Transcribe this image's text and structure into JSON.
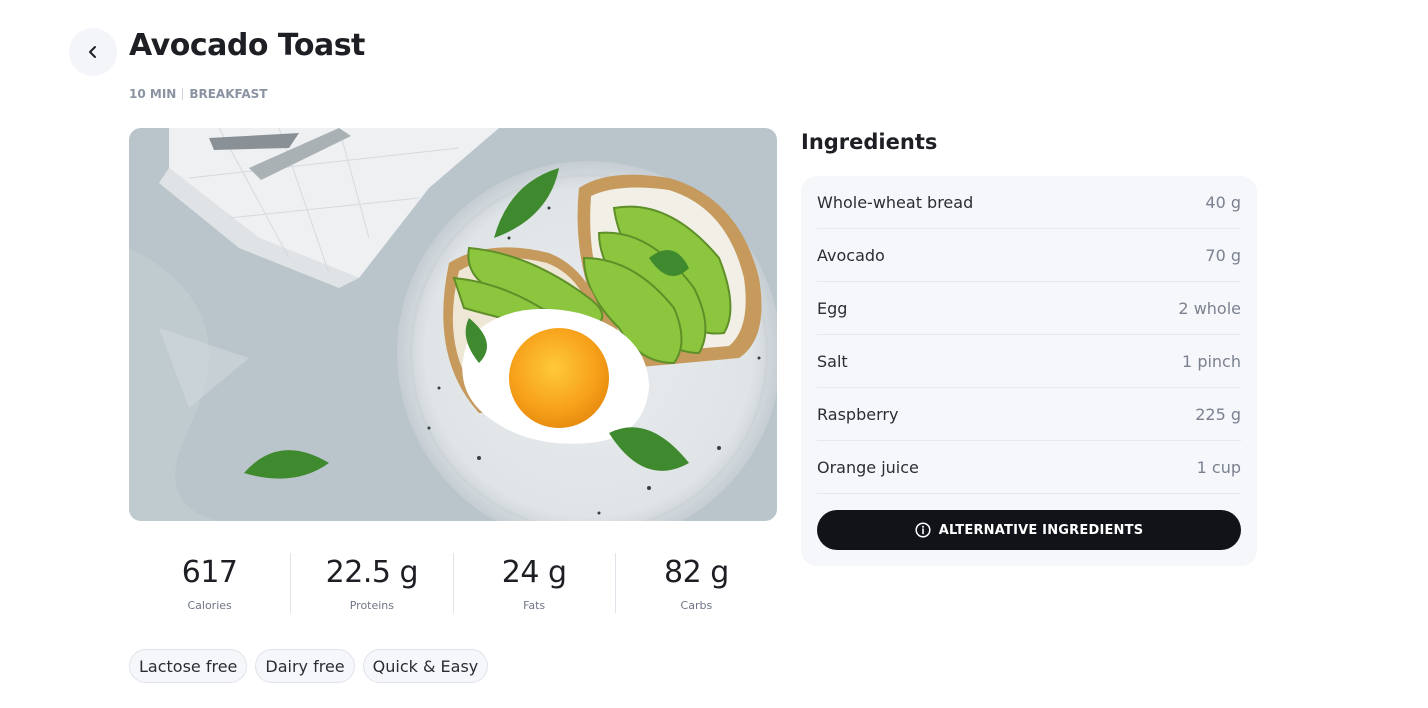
{
  "recipe": {
    "title": "Avocado Toast",
    "time": "10 MIN",
    "category": "BREAKFAST"
  },
  "nutrition": [
    {
      "value": "617",
      "label": "Calories"
    },
    {
      "value": "22.5 g",
      "label": "Proteins"
    },
    {
      "value": "24 g",
      "label": "Fats"
    },
    {
      "value": "82 g",
      "label": "Carbs"
    }
  ],
  "tags": [
    "Lactose free",
    "Dairy free",
    "Quick & Easy"
  ],
  "ingredients": {
    "heading": "Ingredients",
    "items": [
      {
        "name": "Whole-wheat bread",
        "qty": "40 g"
      },
      {
        "name": "Avocado",
        "qty": "70 g"
      },
      {
        "name": "Egg",
        "qty": "2 whole"
      },
      {
        "name": "Salt",
        "qty": "1 pinch"
      },
      {
        "name": "Raspberry",
        "qty": "225 g"
      },
      {
        "name": "Orange juice",
        "qty": "1 cup"
      }
    ],
    "alternative_button": "ALTERNATIVE INGREDIENTS"
  },
  "icons": {
    "back": "chevron-left-icon",
    "info": "info-icon"
  },
  "colors": {
    "button_dark": "#111318",
    "card_bg": "#f6f7fb",
    "egg_yolk": "#f7a11a",
    "avocado": "#8cc63f"
  }
}
